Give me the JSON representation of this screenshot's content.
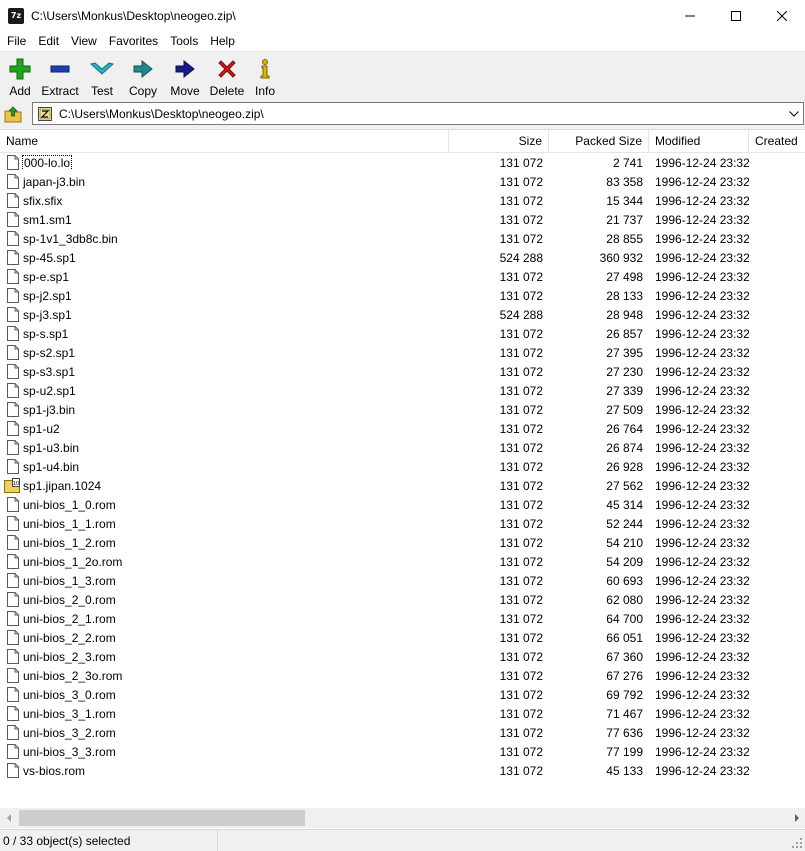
{
  "window": {
    "app_icon_text": "7z",
    "title": "C:\\Users\\Monkus\\Desktop\\neogeo.zip\\"
  },
  "menu": [
    "File",
    "Edit",
    "View",
    "Favorites",
    "Tools",
    "Help"
  ],
  "toolbar": [
    {
      "label": "Add",
      "icon": "add-icon",
      "color": "#1fa51f"
    },
    {
      "label": "Extract",
      "icon": "extract-icon",
      "color": "#1c3fb8"
    },
    {
      "label": "Test",
      "icon": "test-icon",
      "color": "#27b3c4"
    },
    {
      "label": "Copy",
      "icon": "copy-icon",
      "color": "#1f8a8a"
    },
    {
      "label": "Move",
      "icon": "move-icon",
      "color": "#1a1a8c"
    },
    {
      "label": "Delete",
      "icon": "delete-icon",
      "color": "#d01818"
    },
    {
      "label": "Info",
      "icon": "info-icon",
      "color": "#c8a400"
    }
  ],
  "address": {
    "path": "C:\\Users\\Monkus\\Desktop\\neogeo.zip\\"
  },
  "columns": {
    "name": "Name",
    "size": "Size",
    "packed": "Packed Size",
    "modified": "Modified",
    "created": "Created"
  },
  "files": [
    {
      "name": "000-lo.lo",
      "size": "131 072",
      "packed": "2 741",
      "modified": "1996-12-24 23:32",
      "icon": "file-icon"
    },
    {
      "name": "japan-j3.bin",
      "size": "131 072",
      "packed": "83 358",
      "modified": "1996-12-24 23:32",
      "icon": "file-icon"
    },
    {
      "name": "sfix.sfix",
      "size": "131 072",
      "packed": "15 344",
      "modified": "1996-12-24 23:32",
      "icon": "file-icon"
    },
    {
      "name": "sm1.sm1",
      "size": "131 072",
      "packed": "21 737",
      "modified": "1996-12-24 23:32",
      "icon": "file-icon"
    },
    {
      "name": "sp-1v1_3db8c.bin",
      "size": "131 072",
      "packed": "28 855",
      "modified": "1996-12-24 23:32",
      "icon": "file-icon"
    },
    {
      "name": "sp-45.sp1",
      "size": "524 288",
      "packed": "360 932",
      "modified": "1996-12-24 23:32",
      "icon": "file-icon"
    },
    {
      "name": "sp-e.sp1",
      "size": "131 072",
      "packed": "27 498",
      "modified": "1996-12-24 23:32",
      "icon": "file-icon"
    },
    {
      "name": "sp-j2.sp1",
      "size": "131 072",
      "packed": "28 133",
      "modified": "1996-12-24 23:32",
      "icon": "file-icon"
    },
    {
      "name": "sp-j3.sp1",
      "size": "524 288",
      "packed": "28 948",
      "modified": "1996-12-24 23:32",
      "icon": "file-icon"
    },
    {
      "name": "sp-s.sp1",
      "size": "131 072",
      "packed": "26 857",
      "modified": "1996-12-24 23:32",
      "icon": "file-icon"
    },
    {
      "name": "sp-s2.sp1",
      "size": "131 072",
      "packed": "27 395",
      "modified": "1996-12-24 23:32",
      "icon": "file-icon"
    },
    {
      "name": "sp-s3.sp1",
      "size": "131 072",
      "packed": "27 230",
      "modified": "1996-12-24 23:32",
      "icon": "file-icon"
    },
    {
      "name": "sp-u2.sp1",
      "size": "131 072",
      "packed": "27 339",
      "modified": "1996-12-24 23:32",
      "icon": "file-icon"
    },
    {
      "name": "sp1-j3.bin",
      "size": "131 072",
      "packed": "27 509",
      "modified": "1996-12-24 23:32",
      "icon": "file-icon"
    },
    {
      "name": "sp1-u2",
      "size": "131 072",
      "packed": "26 764",
      "modified": "1996-12-24 23:32",
      "icon": "file-icon"
    },
    {
      "name": "sp1-u3.bin",
      "size": "131 072",
      "packed": "26 874",
      "modified": "1996-12-24 23:32",
      "icon": "file-icon"
    },
    {
      "name": "sp1-u4.bin",
      "size": "131 072",
      "packed": "26 928",
      "modified": "1996-12-24 23:32",
      "icon": "file-icon"
    },
    {
      "name": "sp1.jipan.1024",
      "size": "131 072",
      "packed": "27 562",
      "modified": "1996-12-24 23:32",
      "icon": "archive-file-icon"
    },
    {
      "name": "uni-bios_1_0.rom",
      "size": "131 072",
      "packed": "45 314",
      "modified": "1996-12-24 23:32",
      "icon": "file-icon"
    },
    {
      "name": "uni-bios_1_1.rom",
      "size": "131 072",
      "packed": "52 244",
      "modified": "1996-12-24 23:32",
      "icon": "file-icon"
    },
    {
      "name": "uni-bios_1_2.rom",
      "size": "131 072",
      "packed": "54 210",
      "modified": "1996-12-24 23:32",
      "icon": "file-icon"
    },
    {
      "name": "uni-bios_1_2o.rom",
      "size": "131 072",
      "packed": "54 209",
      "modified": "1996-12-24 23:32",
      "icon": "file-icon"
    },
    {
      "name": "uni-bios_1_3.rom",
      "size": "131 072",
      "packed": "60 693",
      "modified": "1996-12-24 23:32",
      "icon": "file-icon"
    },
    {
      "name": "uni-bios_2_0.rom",
      "size": "131 072",
      "packed": "62 080",
      "modified": "1996-12-24 23:32",
      "icon": "file-icon"
    },
    {
      "name": "uni-bios_2_1.rom",
      "size": "131 072",
      "packed": "64 700",
      "modified": "1996-12-24 23:32",
      "icon": "file-icon"
    },
    {
      "name": "uni-bios_2_2.rom",
      "size": "131 072",
      "packed": "66 051",
      "modified": "1996-12-24 23:32",
      "icon": "file-icon"
    },
    {
      "name": "uni-bios_2_3.rom",
      "size": "131 072",
      "packed": "67 360",
      "modified": "1996-12-24 23:32",
      "icon": "file-icon"
    },
    {
      "name": "uni-bios_2_3o.rom",
      "size": "131 072",
      "packed": "67 276",
      "modified": "1996-12-24 23:32",
      "icon": "file-icon"
    },
    {
      "name": "uni-bios_3_0.rom",
      "size": "131 072",
      "packed": "69 792",
      "modified": "1996-12-24 23:32",
      "icon": "file-icon"
    },
    {
      "name": "uni-bios_3_1.rom",
      "size": "131 072",
      "packed": "71 467",
      "modified": "1996-12-24 23:32",
      "icon": "file-icon"
    },
    {
      "name": "uni-bios_3_2.rom",
      "size": "131 072",
      "packed": "77 636",
      "modified": "1996-12-24 23:32",
      "icon": "file-icon"
    },
    {
      "name": "uni-bios_3_3.rom",
      "size": "131 072",
      "packed": "77 199",
      "modified": "1996-12-24 23:32",
      "icon": "file-icon"
    },
    {
      "name": "vs-bios.rom",
      "size": "131 072",
      "packed": "45 133",
      "modified": "1996-12-24 23:32",
      "icon": "file-icon"
    }
  ],
  "status": {
    "text": "0 / 33 object(s) selected"
  }
}
